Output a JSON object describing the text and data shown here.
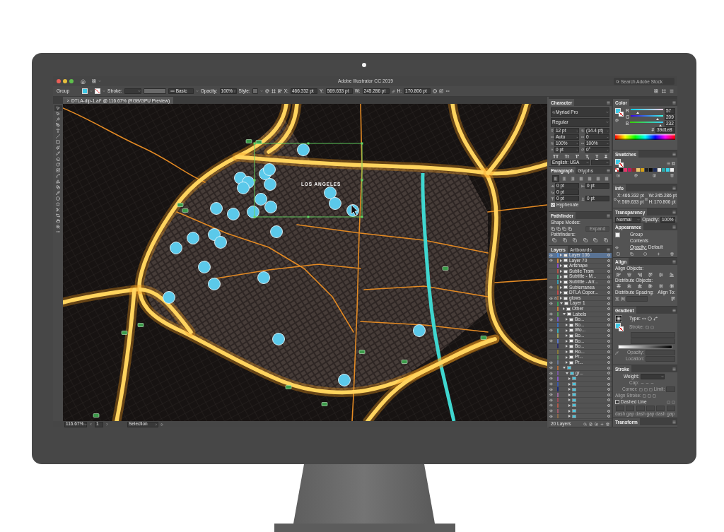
{
  "window": {
    "title": "Adobe Illustrator CC 2019",
    "search_placeholder": "Search Adobe Stock"
  },
  "control_bar": {
    "selection": "Group",
    "stroke_label": "Stroke:",
    "brush": "Basic",
    "opacity_label": "Opacity:",
    "opacity": "100%",
    "style_label": "Style:",
    "transform": [
      {
        "label": "X:",
        "value": "466.332 pt"
      },
      {
        "label": "Y:",
        "value": "569.633 pt"
      },
      {
        "label": "W:",
        "value": "245.286 pt"
      },
      {
        "label": "H:",
        "value": "170.806 pt"
      }
    ]
  },
  "document_tabs": [
    {
      "title": "DTLA-dip-1.ai* @ 116.67% (RGB/GPU Preview)",
      "selected": true
    }
  ],
  "tools": [
    {
      "selected": true
    },
    {
      "selected": false
    },
    {
      "selected": false
    },
    {
      "selected": false
    },
    {
      "selected": false
    },
    {
      "selected": false
    },
    {
      "selected": false
    },
    {
      "selected": false
    },
    {
      "selected": false
    },
    {
      "selected": false
    },
    {
      "selected": false
    },
    {
      "selected": false
    },
    {
      "selected": false
    },
    {
      "selected": false
    },
    {
      "selected": false
    },
    {
      "selected": false
    },
    {
      "selected": false
    },
    {
      "selected": false
    },
    {
      "selected": false
    },
    {
      "selected": false
    },
    {
      "selected": false
    },
    {
      "selected": false
    }
  ],
  "map": {
    "label": "LOS ANGELES"
  },
  "status_bar": {
    "zoom": "116.67%",
    "artboard": "1",
    "tool": "Selection"
  },
  "character": {
    "tabs": [
      {
        "label": "Character",
        "selected": true
      }
    ],
    "font": "Myriad Pro",
    "style": "Regular",
    "fields": [
      "12 pt",
      "(14.4 pt)",
      "Auto",
      "0",
      "100%",
      "100%",
      "0 pt",
      "0°"
    ],
    "style_buttons": [
      {
        "label": "TT",
        "kind": "plain"
      },
      {
        "label": "Tr",
        "kind": "plain"
      },
      {
        "label": "T'",
        "kind": "plain"
      },
      {
        "label": "T,",
        "kind": "plain"
      },
      {
        "label": "T",
        "kind": "underline"
      },
      {
        "label": "T",
        "kind": "strike"
      }
    ],
    "language": "English: USA"
  },
  "paragraph": {
    "tabs": [
      {
        "label": "Paragraph",
        "selected": true
      },
      {
        "label": "Glyphs",
        "selected": false
      }
    ],
    "alignment": [
      {
        "selected": true
      },
      {
        "selected": false
      },
      {
        "selected": false
      },
      {
        "selected": false
      },
      {
        "selected": false
      },
      {
        "selected": false
      },
      {
        "selected": false
      }
    ],
    "indents": [
      "0 pt",
      "0 pt",
      "0 pt",
      "0 pt",
      "0 pt"
    ],
    "hyphenate": {
      "label": "Hyphenate",
      "checked": true
    }
  },
  "pathfinder": {
    "tabs": [
      {
        "label": "Pathfinder",
        "selected": true
      }
    ],
    "shape_modes": "Shape Modes:",
    "expand": {
      "label": "Expand",
      "disabled": true
    },
    "pathfinders": "Pathfinders:"
  },
  "layers": {
    "tabs": [
      {
        "label": "Layers",
        "selected": true
      },
      {
        "label": "Artboards",
        "selected": false
      }
    ],
    "items": [
      {
        "name": "Layer 106",
        "color": "#4f8bd6",
        "kind": "art",
        "visible": true,
        "locked": false,
        "selected": true,
        "expanded": false
      },
      {
        "name": "Layer 70",
        "color": "#d08a3a",
        "kind": "art",
        "visible": true,
        "locked": false,
        "selected": false,
        "expanded": false
      },
      {
        "name": "Artshape",
        "color": "#8a4fc9",
        "kind": "art",
        "visible": false,
        "locked": false,
        "selected": false,
        "expanded": false
      },
      {
        "name": "Sublie Tram",
        "color": "#b5544a",
        "kind": "art",
        "visible": false,
        "locked": false,
        "selected": false,
        "expanded": false
      },
      {
        "name": "Subtitle - M...",
        "color": "#4aa37a",
        "kind": "art",
        "visible": false,
        "locked": false,
        "selected": false,
        "expanded": false
      },
      {
        "name": "Subtitle - Arr...",
        "color": "#3aa0b5",
        "kind": "art",
        "visible": false,
        "locked": false,
        "selected": false,
        "expanded": false
      },
      {
        "name": "Subterranea",
        "color": "#8a7a3a",
        "kind": "art",
        "visible": true,
        "locked": false,
        "selected": false,
        "expanded": false
      },
      {
        "name": "DTLA Copor...",
        "color": "#c44a4a",
        "kind": "art",
        "visible": false,
        "locked": false,
        "selected": false,
        "expanded": false
      },
      {
        "name": "glows",
        "color": "#9a6a4a",
        "kind": "art",
        "visible": true,
        "locked": true,
        "selected": false,
        "expanded": false
      },
      {
        "name": "Layer 1",
        "color": "#3aa35a",
        "kind": "art",
        "visible": true,
        "locked": false,
        "selected": false,
        "expanded": true,
        "children": [
          {
            "name": "Other",
            "color": "#c87a3a",
            "kind": "art",
            "visible": false,
            "locked": false,
            "selected": false,
            "expanded": false
          },
          {
            "name": "Labels",
            "color": "#5aa05a",
            "kind": "art",
            "visible": true,
            "locked": false,
            "selected": false,
            "expanded": true,
            "children": [
              {
                "name": "Bo...",
                "color": "#7a5ac9",
                "kind": "art",
                "visible": true,
                "locked": false,
                "selected": false,
                "expanded": false
              },
              {
                "name": "Bo...",
                "color": "#3a6fc0",
                "kind": "art",
                "visible": false,
                "locked": false,
                "selected": false,
                "expanded": false
              },
              {
                "name": "Wo...",
                "color": "#3ab0c0",
                "kind": "art",
                "visible": true,
                "locked": false,
                "selected": false,
                "expanded": false
              },
              {
                "name": "Bo...",
                "color": "#a0a05a",
                "kind": "art",
                "visible": false,
                "locked": false,
                "selected": false,
                "expanded": false
              },
              {
                "name": "Bo...",
                "color": "#5a7ac9",
                "kind": "art",
                "visible": true,
                "locked": false,
                "selected": false,
                "expanded": false
              },
              {
                "name": "Bo...",
                "color": "#2a2a6a",
                "kind": "art",
                "visible": false,
                "locked": false,
                "selected": false,
                "expanded": false
              },
              {
                "name": "Ro...",
                "color": "#8a7a3a",
                "kind": "art",
                "visible": false,
                "locked": false,
                "selected": false,
                "expanded": false
              },
              {
                "name": "Pr...",
                "color": "#5a8a5a",
                "kind": "art",
                "visible": false,
                "locked": false,
                "selected": false,
                "expanded": false
              },
              {
                "name": "Pr...",
                "color": "#6a7a9a",
                "kind": "art",
                "visible": true,
                "locked": false,
                "selected": false,
                "expanded": false
              }
            ]
          },
          {
            "color": "#b06a3a",
            "kind": "marker",
            "visible": true,
            "locked": false,
            "selected": false,
            "expanded": true,
            "children": [
              {
                "name": "gr...",
                "color": "#7a5aa0",
                "kind": "marker",
                "visible": true,
                "locked": false,
                "selected": false,
                "expanded": true,
                "children": [
                  {
                    "color": "#8a5ac9",
                    "kind": "marker",
                    "visible": true,
                    "locked": false,
                    "selected": false,
                    "expanded": false
                  },
                  {
                    "color": "#3a5ab0",
                    "kind": "marker",
                    "visible": true,
                    "locked": false,
                    "selected": false,
                    "expanded": false
                  },
                  {
                    "color": "#1a2a7a",
                    "kind": "marker",
                    "visible": true,
                    "locked": false,
                    "selected": false,
                    "expanded": false
                  },
                  {
                    "color": "#9a6aa0",
                    "kind": "marker",
                    "visible": true,
                    "locked": false,
                    "selected": false,
                    "expanded": false
                  },
                  {
                    "color": "#a04a5a",
                    "kind": "marker",
                    "visible": true,
                    "locked": false,
                    "selected": false,
                    "expanded": false
                  },
                  {
                    "color": "#b05a4a",
                    "kind": "marker",
                    "visible": true,
                    "locked": false,
                    "selected": false,
                    "expanded": false
                  },
                  {
                    "color": "#a05a6a",
                    "kind": "marker",
                    "visible": true,
                    "locked": false,
                    "selected": false,
                    "expanded": false
                  },
                  {
                    "color": "#8a6a4a",
                    "kind": "marker",
                    "visible": true,
                    "locked": false,
                    "selected": false,
                    "expanded": false
                  }
                ]
              }
            ]
          }
        ]
      }
    ],
    "count": "20 Layers"
  },
  "color": {
    "tabs": [
      {
        "label": "Color",
        "selected": true
      }
    ],
    "channels": [
      {
        "name": "R",
        "level": 0.22,
        "value": "57"
      },
      {
        "name": "G",
        "level": 0.82,
        "value": "209"
      },
      {
        "name": "B",
        "level": 0.91,
        "value": "232"
      }
    ],
    "hex_label": "#",
    "hex": "39d1e8"
  },
  "swatches": {
    "tabs": [
      {
        "label": "Swatches",
        "selected": true
      }
    ],
    "items": [
      {
        "kind": "none"
      },
      {
        "kind": "color",
        "color": "#111111"
      },
      {
        "kind": "color",
        "color": "#e8356a"
      },
      {
        "kind": "color",
        "color": "#c2185b"
      },
      {
        "kind": "color",
        "color": "#8b2e2e"
      },
      {
        "kind": "color",
        "color": "#e9c46a"
      },
      {
        "kind": "color",
        "color": "#d4a017"
      },
      {
        "kind": "color",
        "color": "#222222"
      },
      {
        "kind": "color",
        "color": "#0b0b0b"
      },
      {
        "kind": "color",
        "color": "#1f2d5a"
      },
      {
        "kind": "color",
        "color": "#e8e8e8"
      },
      {
        "kind": "color",
        "color": "#2aa8a8"
      },
      {
        "kind": "color",
        "color": "#39d1e8"
      },
      {
        "kind": "color",
        "color": "#f2f2f2"
      }
    ]
  },
  "info": {
    "tabs": [
      {
        "label": "Info",
        "selected": true
      }
    ],
    "values": [
      {
        "label": "X:",
        "value": "466.332 pt"
      },
      {
        "label": "Y:",
        "value": "569.633 pt"
      },
      {
        "label": "W:",
        "value": "245.286 pt"
      },
      {
        "label": "H:",
        "value": "170.806 pt"
      }
    ]
  },
  "transparency": {
    "tabs": [
      {
        "label": "Transparency",
        "selected": true
      }
    ],
    "mode": "Normal",
    "opacity_label": "Opacity:",
    "opacity": "100%"
  },
  "appearance": {
    "tabs": [
      {
        "label": "Appearance",
        "selected": true
      }
    ],
    "object": "Group",
    "contents": "Contents",
    "opacity_label": "Opacity:",
    "opacity": "Default"
  },
  "align": {
    "tabs": [
      {
        "label": "Align",
        "selected": true
      }
    ],
    "align_objects": "Align Objects:",
    "distribute_objects": "Distribute Objects:",
    "distribute_spacing": "Distribute Spacing:",
    "align_to": "Align To:"
  },
  "gradient": {
    "tabs": [
      {
        "label": "Gradient",
        "selected": true
      }
    ],
    "type_label": "Type:",
    "stroke": {
      "label": "Stroke:",
      "disabled": true
    },
    "opacity": {
      "label": "Opacity:",
      "disabled": true
    },
    "location": {
      "label": "Location:",
      "disabled": true
    }
  },
  "stroke": {
    "tabs": [
      {
        "label": "Stroke",
        "selected": true
      }
    ],
    "weight": "Weight:",
    "cap": {
      "label": "Cap:",
      "disabled": true
    },
    "corner": {
      "label": "Corner:",
      "disabled": true
    },
    "limit": {
      "label": "Limit:",
      "disabled": true
    },
    "align_stroke": {
      "label": "Align Stroke:",
      "disabled": true
    },
    "dashed": {
      "label": "Dashed Line",
      "checked": false
    },
    "dash_fields": [
      {
        "label": "dash",
        "disabled": true
      },
      {
        "label": "gap",
        "disabled": true
      },
      {
        "label": "dash",
        "disabled": true
      },
      {
        "label": "gap",
        "disabled": true
      },
      {
        "label": "dash",
        "disabled": true
      },
      {
        "label": "gap",
        "disabled": true
      }
    ]
  },
  "transform": {
    "tabs": [
      {
        "label": "Transform",
        "selected": true
      }
    ]
  }
}
